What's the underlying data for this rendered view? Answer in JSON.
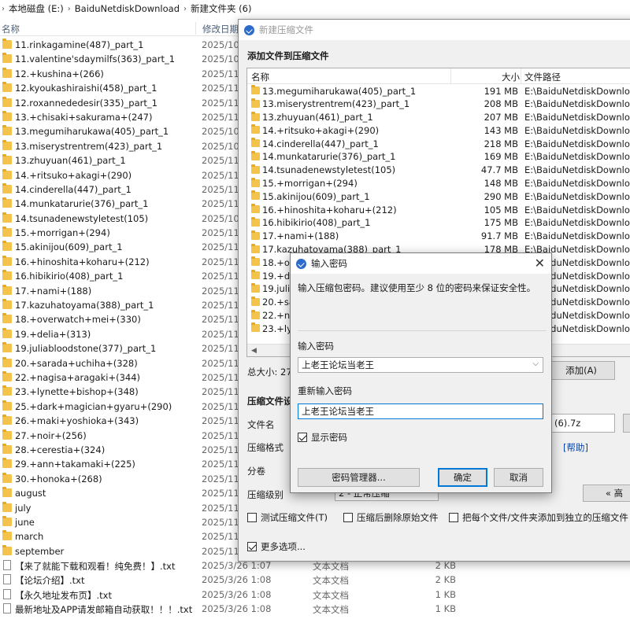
{
  "explorer": {
    "breadcrumb": [
      "本地磁盘 (E:)",
      "BaiduNetdiskDownload",
      "新建文件夹 (6)"
    ],
    "columns": {
      "name": "名称",
      "date": "修改日期"
    },
    "files": [
      {
        "name": "11.rinkagamine(487)_part_1",
        "date": "2025/10/",
        "kind": "folder"
      },
      {
        "name": "11.valentine'sdaymilfs(363)_part_1",
        "date": "2025/10/",
        "kind": "folder"
      },
      {
        "name": "12.+kushina+(266)",
        "date": "2025/11/",
        "kind": "folder"
      },
      {
        "name": "12.kyoukashiraishi(458)_part_1",
        "date": "2025/11/",
        "kind": "folder"
      },
      {
        "name": "12.roxannededesir(335)_part_1",
        "date": "2025/11/",
        "kind": "folder"
      },
      {
        "name": "13.+chisaki+sakurama+(247)",
        "date": "2025/11/",
        "kind": "folder"
      },
      {
        "name": "13.megumiharukawa(405)_part_1",
        "date": "2025/10/",
        "kind": "folder"
      },
      {
        "name": "13.miserystrentrem(423)_part_1",
        "date": "2025/10/",
        "kind": "folder"
      },
      {
        "name": "13.zhuyuan(461)_part_1",
        "date": "2025/11/",
        "kind": "folder"
      },
      {
        "name": "14.+ritsuko+akagi+(290)",
        "date": "2025/11/",
        "kind": "folder"
      },
      {
        "name": "14.cinderella(447)_part_1",
        "date": "2025/11/",
        "kind": "folder"
      },
      {
        "name": "14.munkatarurie(376)_part_1",
        "date": "2025/11/",
        "kind": "folder"
      },
      {
        "name": "14.tsunadenewstyletest(105)",
        "date": "2025/10/",
        "kind": "folder"
      },
      {
        "name": "15.+morrigan+(294)",
        "date": "2025/11/",
        "kind": "folder"
      },
      {
        "name": "15.akinijou(609)_part_1",
        "date": "2025/11/",
        "kind": "folder"
      },
      {
        "name": "16.+hinoshita+koharu+(212)",
        "date": "2025/11/",
        "kind": "folder"
      },
      {
        "name": "16.hibikirio(408)_part_1",
        "date": "2025/11/",
        "kind": "folder"
      },
      {
        "name": "17.+nami+(188)",
        "date": "2025/11/",
        "kind": "folder"
      },
      {
        "name": "17.kazuhatoyama(388)_part_1",
        "date": "2025/11/",
        "kind": "folder"
      },
      {
        "name": "18.+overwatch+mei+(330)",
        "date": "2025/11/",
        "kind": "folder"
      },
      {
        "name": "19.+delia+(313)",
        "date": "2025/11/",
        "kind": "folder"
      },
      {
        "name": "19.juliabloodstone(377)_part_1",
        "date": "2025/11/",
        "kind": "folder"
      },
      {
        "name": "20.+sarada+uchiha+(328)",
        "date": "2025/11/",
        "kind": "folder"
      },
      {
        "name": "22.+nagisa+aragaki+(344)",
        "date": "2025/11/",
        "kind": "folder"
      },
      {
        "name": "23.+lynette+bishop+(348)",
        "date": "2025/11/",
        "kind": "folder"
      },
      {
        "name": "25.+dark+magician+gyaru+(290)",
        "date": "2025/11/",
        "kind": "folder"
      },
      {
        "name": "26.+maki+yoshioka+(343)",
        "date": "2025/11/",
        "kind": "folder"
      },
      {
        "name": "27.+noir+(256)",
        "date": "2025/11/",
        "kind": "folder"
      },
      {
        "name": "28.+cerestia+(324)",
        "date": "2025/11/",
        "kind": "folder"
      },
      {
        "name": "29.+ann+takamaki+(225)",
        "date": "2025/11/",
        "kind": "folder"
      },
      {
        "name": "30.+honoka+(268)",
        "date": "2025/11/",
        "kind": "folder"
      },
      {
        "name": "august",
        "date": "2025/11/",
        "kind": "folder"
      },
      {
        "name": "july",
        "date": "2025/11/",
        "kind": "folder"
      },
      {
        "name": "june",
        "date": "2025/11/",
        "kind": "folder"
      },
      {
        "name": "march",
        "date": "2025/11/",
        "kind": "folder"
      },
      {
        "name": "september",
        "date": "2025/11/",
        "kind": "folder"
      },
      {
        "name": "【来了就能下载和观看！纯免费！】.txt",
        "date": "2025/3/26 1:07",
        "type": "文本文档",
        "size": "2 KB",
        "kind": "txt"
      },
      {
        "name": "【论坛介绍】.txt",
        "date": "2025/3/26 1:08",
        "type": "文本文档",
        "size": "2 KB",
        "kind": "txt"
      },
      {
        "name": "【永久地址发布页】.txt",
        "date": "2025/3/26 1:08",
        "type": "文本文档",
        "size": "1 KB",
        "kind": "txt"
      },
      {
        "name": "最新地址及APP请发邮箱自动获取！！！.txt",
        "date": "2025/3/26 1:08",
        "type": "文本文档",
        "size": "1 KB",
        "kind": "txt"
      }
    ]
  },
  "zip_dialog": {
    "title": "新建压缩文件",
    "heading": "添加文件到压缩文件",
    "columns": {
      "name": "名称",
      "size": "大小",
      "path": "文件路径"
    },
    "items": [
      {
        "name": "13.megumiharukawa(405)_part_1",
        "size": "191 MB",
        "path": "E:\\BaiduNetdiskDownload"
      },
      {
        "name": "13.miserystrentrem(423)_part_1",
        "size": "208 MB",
        "path": "E:\\BaiduNetdiskDownload"
      },
      {
        "name": "13.zhuyuan(461)_part_1",
        "size": "207 MB",
        "path": "E:\\BaiduNetdiskDownload"
      },
      {
        "name": "14.+ritsuko+akagi+(290)",
        "size": "143 MB",
        "path": "E:\\BaiduNetdiskDownload"
      },
      {
        "name": "14.cinderella(447)_part_1",
        "size": "218 MB",
        "path": "E:\\BaiduNetdiskDownload"
      },
      {
        "name": "14.munkatarurie(376)_part_1",
        "size": "169 MB",
        "path": "E:\\BaiduNetdiskDownload"
      },
      {
        "name": "14.tsunadenewstyletest(105)",
        "size": "47.7 MB",
        "path": "E:\\BaiduNetdiskDownload"
      },
      {
        "name": "15.+morrigan+(294)",
        "size": "148 MB",
        "path": "E:\\BaiduNetdiskDownload"
      },
      {
        "name": "15.akinijou(609)_part_1",
        "size": "290 MB",
        "path": "E:\\BaiduNetdiskDownload"
      },
      {
        "name": "16.+hinoshita+koharu+(212)",
        "size": "105 MB",
        "path": "E:\\BaiduNetdiskDownload"
      },
      {
        "name": "16.hibikirio(408)_part_1",
        "size": "175 MB",
        "path": "E:\\BaiduNetdiskDownload"
      },
      {
        "name": "17.+nami+(188)",
        "size": "91.7 MB",
        "path": "E:\\BaiduNetdiskDownload"
      },
      {
        "name": "17.kazuhatoyama(388)_part_1",
        "size": "178 MB",
        "path": "E:\\BaiduNetdiskDownload"
      },
      {
        "name": "18.+ov",
        "size": "",
        "path": "E:\\BaiduNetdiskDownload"
      },
      {
        "name": "19.+de",
        "size": "",
        "path": "E:\\BaiduNetdiskDownload"
      },
      {
        "name": "19.julia",
        "size": "",
        "path": "E:\\BaiduNetdiskDownload"
      },
      {
        "name": "20.+sar",
        "size": "",
        "path": "E:\\BaiduNetdiskDownload"
      },
      {
        "name": "22.+na",
        "size": "",
        "path": "E:\\BaiduNetdiskDownload"
      },
      {
        "name": "23.+lyn",
        "size": "",
        "path": "E:\\BaiduNetdiskDownload"
      }
    ],
    "total_size": "总大小: 27.",
    "add_button": "添加(A)",
    "settings_title": "压缩文件设",
    "filename_label": "文件名",
    "filename_value": "(6).7z",
    "format_label": "压缩格式",
    "help_link": "[帮助]",
    "split_label": "分卷",
    "level_label": "压缩级别",
    "level_value": "2 - 正常压缩",
    "advanced_button": "« 高",
    "test_checkbox": "测试压缩文件(T)",
    "delete_checkbox": "压缩后删除原始文件",
    "separate_checkbox": "把每个文件/文件夹添加到独立的压缩文件",
    "more_options": "更多选项..."
  },
  "password_dialog": {
    "title": "输入密码",
    "description": "输入压缩包密码。建议使用至少 8 位的密码来保证安全性。",
    "password_label": "输入密码",
    "password_value": "上老王论坛当老王",
    "confirm_label": "重新输入密码",
    "confirm_value": "上老王论坛当老王",
    "show_password": "显示密码",
    "manager_button": "密码管理器...",
    "ok_button": "确定",
    "cancel_button": "取消"
  }
}
